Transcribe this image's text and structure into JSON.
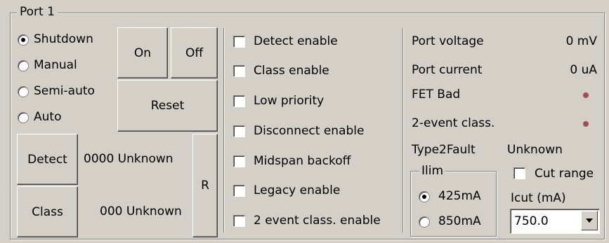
{
  "group": {
    "title": "Port 1"
  },
  "mode": {
    "options": [
      {
        "label": "Shutdown",
        "checked": true
      },
      {
        "label": "Manual",
        "checked": false
      },
      {
        "label": "Semi-auto",
        "checked": false
      },
      {
        "label": "Auto",
        "checked": false
      }
    ]
  },
  "buttons": {
    "on": "On",
    "off": "Off",
    "reset": "Reset",
    "detect": "Detect",
    "class": "Class",
    "r": "R"
  },
  "detect_status": "0000 Unknown",
  "class_status": "000 Unknown",
  "checkboxes": [
    {
      "label": "Detect enable",
      "checked": false
    },
    {
      "label": "Class enable",
      "checked": false
    },
    {
      "label": "Low priority",
      "checked": false
    },
    {
      "label": "Disconnect enable",
      "checked": false
    },
    {
      "label": "Midspan backoff",
      "checked": false
    },
    {
      "label": "Legacy enable",
      "checked": false
    },
    {
      "label": "2 event class. enable",
      "checked": false
    }
  ],
  "status": {
    "port_voltage_label": "Port voltage",
    "port_voltage_value": "0 mV",
    "port_current_label": "Port current",
    "port_current_value": "0 uA",
    "fet_bad_label": "FET Bad",
    "two_event_label": "2-event class.",
    "type2fault_label": "Type2Fault",
    "type2fault_value": "Unknown",
    "led_color": "#a05050"
  },
  "ilim": {
    "title": "Ilim",
    "options": [
      {
        "label": "425mA",
        "checked": true
      },
      {
        "label": "850mA",
        "checked": false
      }
    ]
  },
  "cut_range": {
    "label": "Cut range",
    "checked": false
  },
  "icut": {
    "label": "Icut (mA)",
    "value": "750.0"
  }
}
